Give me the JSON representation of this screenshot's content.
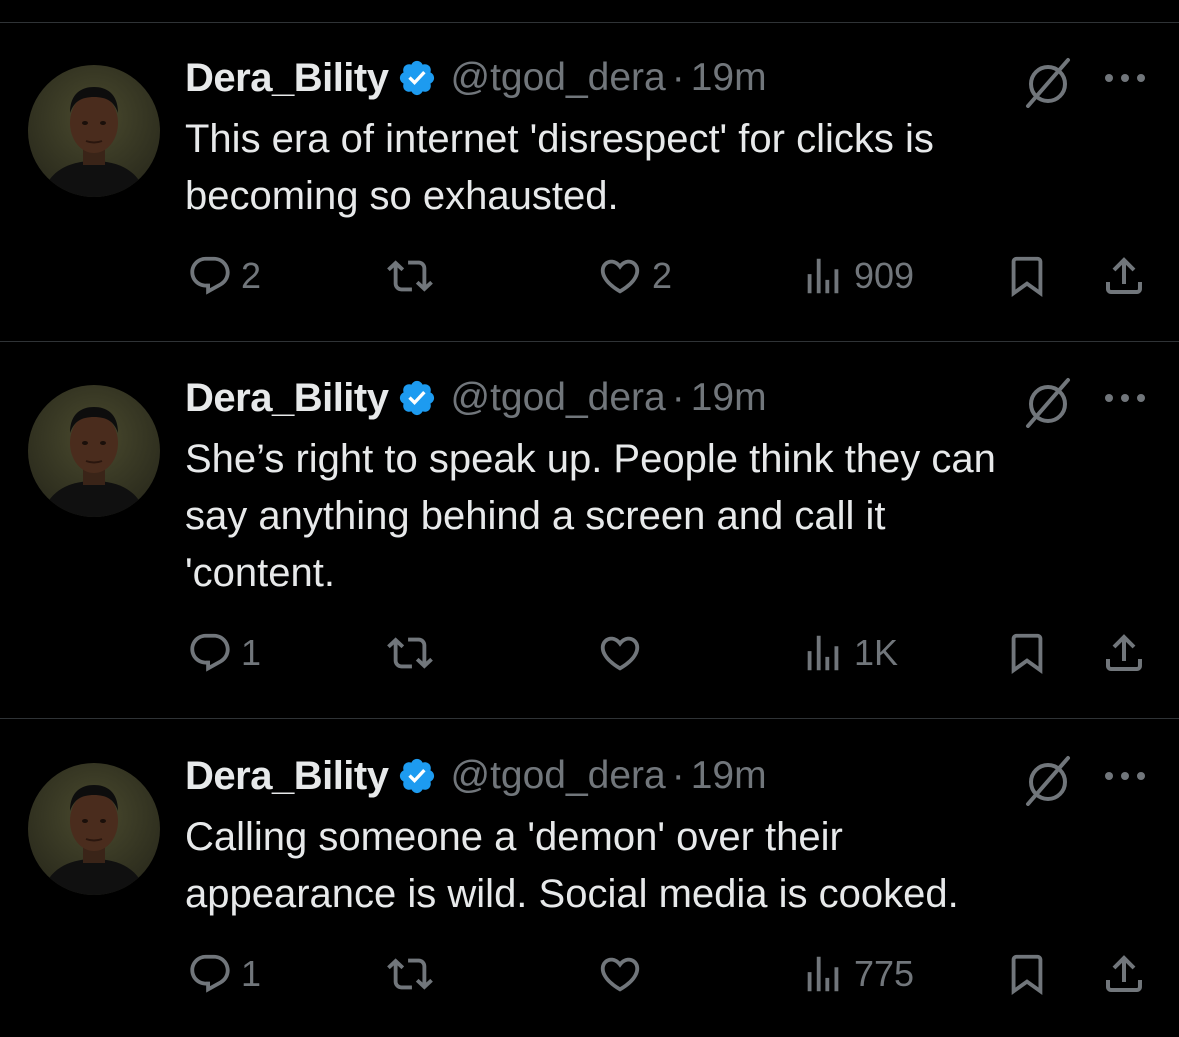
{
  "tweets": [
    {
      "display_name": "Dera_Bility",
      "handle": "@tgod_dera",
      "separator": "·",
      "time": "19m",
      "text_lines": [
        "This era of internet 'disrespect' for clicks is",
        "becoming so exhausted."
      ],
      "replies": "2",
      "retweets": "",
      "likes": "2",
      "views": "909"
    },
    {
      "display_name": "Dera_Bility",
      "handle": "@tgod_dera",
      "separator": "·",
      "time": "19m",
      "text_lines": [
        "She’s right to speak up. People think they can",
        "say anything behind a screen and call it",
        "'content."
      ],
      "replies": "1",
      "retweets": "",
      "likes": "",
      "views": "1K"
    },
    {
      "display_name": "Dera_Bility",
      "handle": "@tgod_dera",
      "separator": "·",
      "time": "19m",
      "text_lines": [
        "Calling someone a 'demon' over their",
        "appearance is wild. Social media is cooked."
      ],
      "replies": "1",
      "retweets": "",
      "likes": "",
      "views": "775"
    }
  ],
  "icons": {
    "verified": "verified-badge-icon",
    "grok": "grok-icon",
    "more": "more-icon",
    "reply": "reply-icon",
    "retweet": "retweet-icon",
    "like": "like-icon",
    "views": "views-icon",
    "bookmark": "bookmark-icon",
    "share": "share-icon"
  },
  "colors": {
    "background": "#000000",
    "text": "#e7e9ea",
    "muted": "#71767b",
    "divider": "#2f3336",
    "verified": "#1d9bf0"
  }
}
